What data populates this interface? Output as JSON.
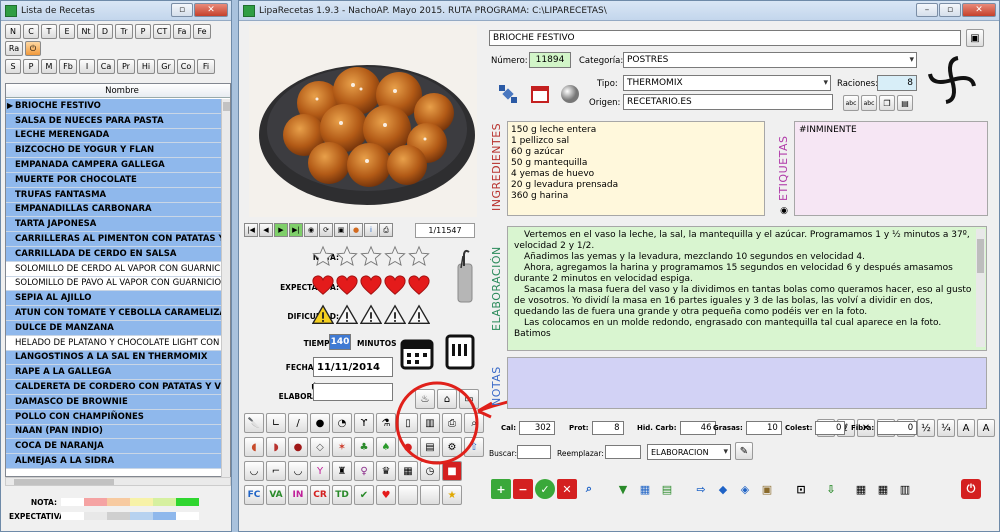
{
  "left_window": {
    "title": "Lista de Recetas",
    "letter_buttons_row1": [
      "N",
      "C",
      "T",
      "E",
      "Nt",
      "D",
      "Tr",
      "P",
      "CT",
      "Fa",
      "Fe",
      "Ra"
    ],
    "letter_buttons_row2": [
      "S",
      "P",
      "M",
      "Fb",
      "I",
      "Ca",
      "Pr",
      "Hi",
      "Gr",
      "Co",
      "Fi"
    ],
    "grid_header": "Nombre",
    "recipes": [
      {
        "name": "BRIOCHE FESTIVO",
        "bold": true,
        "current": true
      },
      {
        "name": "SALSA DE NUECES PARA PASTA",
        "bold": true
      },
      {
        "name": "LECHE MERENGADA",
        "bold": true
      },
      {
        "name": "BIZCOCHO DE YOGUR Y FLAN",
        "bold": true
      },
      {
        "name": "EMPANADA CAMPERA GALLEGA",
        "bold": true
      },
      {
        "name": "MUERTE POR CHOCOLATE",
        "bold": true
      },
      {
        "name": "TRUFAS FANTASMA",
        "bold": true
      },
      {
        "name": "EMPANADILLAS CARBONARA",
        "bold": true
      },
      {
        "name": "TARTA JAPONESA",
        "bold": true
      },
      {
        "name": "CARRILLERAS AL PIMENTON CON PATATAS Y ZANA",
        "bold": true
      },
      {
        "name": "CARRILLADA DE CERDO EN SALSA",
        "bold": true
      },
      {
        "name": "SOLOMILLO DE CERDO AL VAPOR CON GUARNICION",
        "bold": false
      },
      {
        "name": "SOLOMILLO DE PAVO AL VAPOR CON GUARNICION",
        "bold": false
      },
      {
        "name": "SEPIA AL AJILLO",
        "bold": true
      },
      {
        "name": "ATUN CON TOMATE Y CEBOLLA CARAMELIZADA",
        "bold": true
      },
      {
        "name": "DULCE DE MANZANA",
        "bold": true
      },
      {
        "name": "HELADO DE PLATANO Y CHOCOLATE LIGHT CON TH",
        "bold": false
      },
      {
        "name": "LANGOSTINOS A LA SAL EN THERMOMIX",
        "bold": true
      },
      {
        "name": "RAPE A LA GALLEGA",
        "bold": true
      },
      {
        "name": "CALDERETA DE CORDERO CON PATATAS Y VERDUR",
        "bold": true
      },
      {
        "name": "DAMASCO DE BROWNIE",
        "bold": true
      },
      {
        "name": "POLLO CON CHAMPIÑONES",
        "bold": true
      },
      {
        "name": "NAAN (PAN INDIO)",
        "bold": true
      },
      {
        "name": "COCA DE NARANJA",
        "bold": true
      },
      {
        "name": "ALMEJAS A LA SIDRA",
        "bold": true
      }
    ],
    "legend": {
      "nota_label": "NOTA:",
      "expectativa_label": "EXPECTATIVA:",
      "nota_colors": [
        "#ffffff",
        "#f5a3a3",
        "#f7caa0",
        "#f7f2a8",
        "#d6f0a0",
        "#2fd62f"
      ],
      "expectativa_colors": [
        "#ffffff",
        "#e8e8e8",
        "#cfcfcf",
        "#b7d2f0",
        "#8fb8ec",
        "#ffffff"
      ]
    }
  },
  "right_window": {
    "title": "LipaRecetas 1.9.3 - NachoAP. Mayo 2015. RUTA PROGRAMA: C:\\LIPARECETAS\\",
    "recipe_title": "BRIOCHE FESTIVO",
    "numero_label": "Número:",
    "numero": "11894",
    "categoria_label": "Categoría:",
    "categoria": "POSTRES",
    "tipo_label": "Tipo:",
    "tipo": "THERMOMIX",
    "raciones_label": "Raciones:",
    "raciones": "8",
    "origen_label": "Origen:",
    "origen": "RECETARIO.ES",
    "record_counter": "1/11547",
    "nota_label": "NOTA:",
    "nota_stars": 0,
    "expectativa_label": "EXPECTATIVA:",
    "expectativa_hearts": 5,
    "dificultad_label": "DIFICULTAD:",
    "dificultad_level": 1,
    "tiempo_label": "TIEMPO:",
    "tiempo": "140",
    "minutos_label": "MINUTOS",
    "fecha_alta_label": "FECHA ALTA:",
    "fecha_alta": "11/11/2014",
    "ultima_label": "ÚLTIMA ELABORACIÓN:",
    "ultima": "",
    "ingredientes_label": "INGREDIENTES",
    "ingredientes": [
      "150 g leche entera",
      "1 pellizco sal",
      "60 g azúcar",
      "50 g mantequilla",
      "4 yemas de huevo",
      "20 g levadura prensada",
      "360 g harina"
    ],
    "etiquetas_label": "ETIQUETAS",
    "etiquetas": "#INMINENTE",
    "elaboracion_label": "ELABORACIÓN",
    "elaboracion": [
      "Vertemos en el vaso la leche, la sal, la mantequilla y el azúcar. Programamos 1 y ½ minutos a 37º, velocidad 2 y 1/2.",
      "Añadimos las yemas y la levadura, mezclando 10 segundos en velocidad 4.",
      "Ahora, agregamos la harina y programamos 15 segundos en velocidad 6 y después amasamos durante 2 minutos en velocidad espiga.",
      "Sacamos la masa fuera del vaso y la dividimos en tantas bolas como queramos hacer, eso al gusto de vosotros. Yo dividí la masa en 16 partes iguales y 3 de las bolas, las volví a dividir en dos, quedando las de fuera una grande y otra pequeña como podéis ver en la foto.",
      "Las colocamos en un molde redondo, engrasado con mantequilla tal cual aparece en la foto. Batimos"
    ],
    "notas_label": "NOTAS",
    "notas": "",
    "nutrition": [
      {
        "label": "Cal:",
        "value": "302"
      },
      {
        "label": "Prot:",
        "value": "8"
      },
      {
        "label": "Hid. Carb:",
        "value": "46"
      },
      {
        "label": "Grasas:",
        "value": "10"
      },
      {
        "label": "Colest:",
        "value": "0"
      },
      {
        "label": "Fibra:",
        "value": "0"
      }
    ],
    "buscar_label": "Buscar:",
    "buscar": "",
    "reemplazar_label": "Reemplazar:",
    "reemplazar": "",
    "search_scope": "ELABORACION",
    "diet_buttons": [
      "FC",
      "VA",
      "IN",
      "CR",
      "TD"
    ],
    "accent_colors": {
      "selection": "#8fb8ec",
      "ingredientes_bg": "#fff8dc",
      "etiquetas_bg": "#f6e6f4",
      "elaboracion_bg": "#d9f5d0",
      "notas_bg": "#d2d2f5",
      "annotation": "#e0201a"
    }
  }
}
